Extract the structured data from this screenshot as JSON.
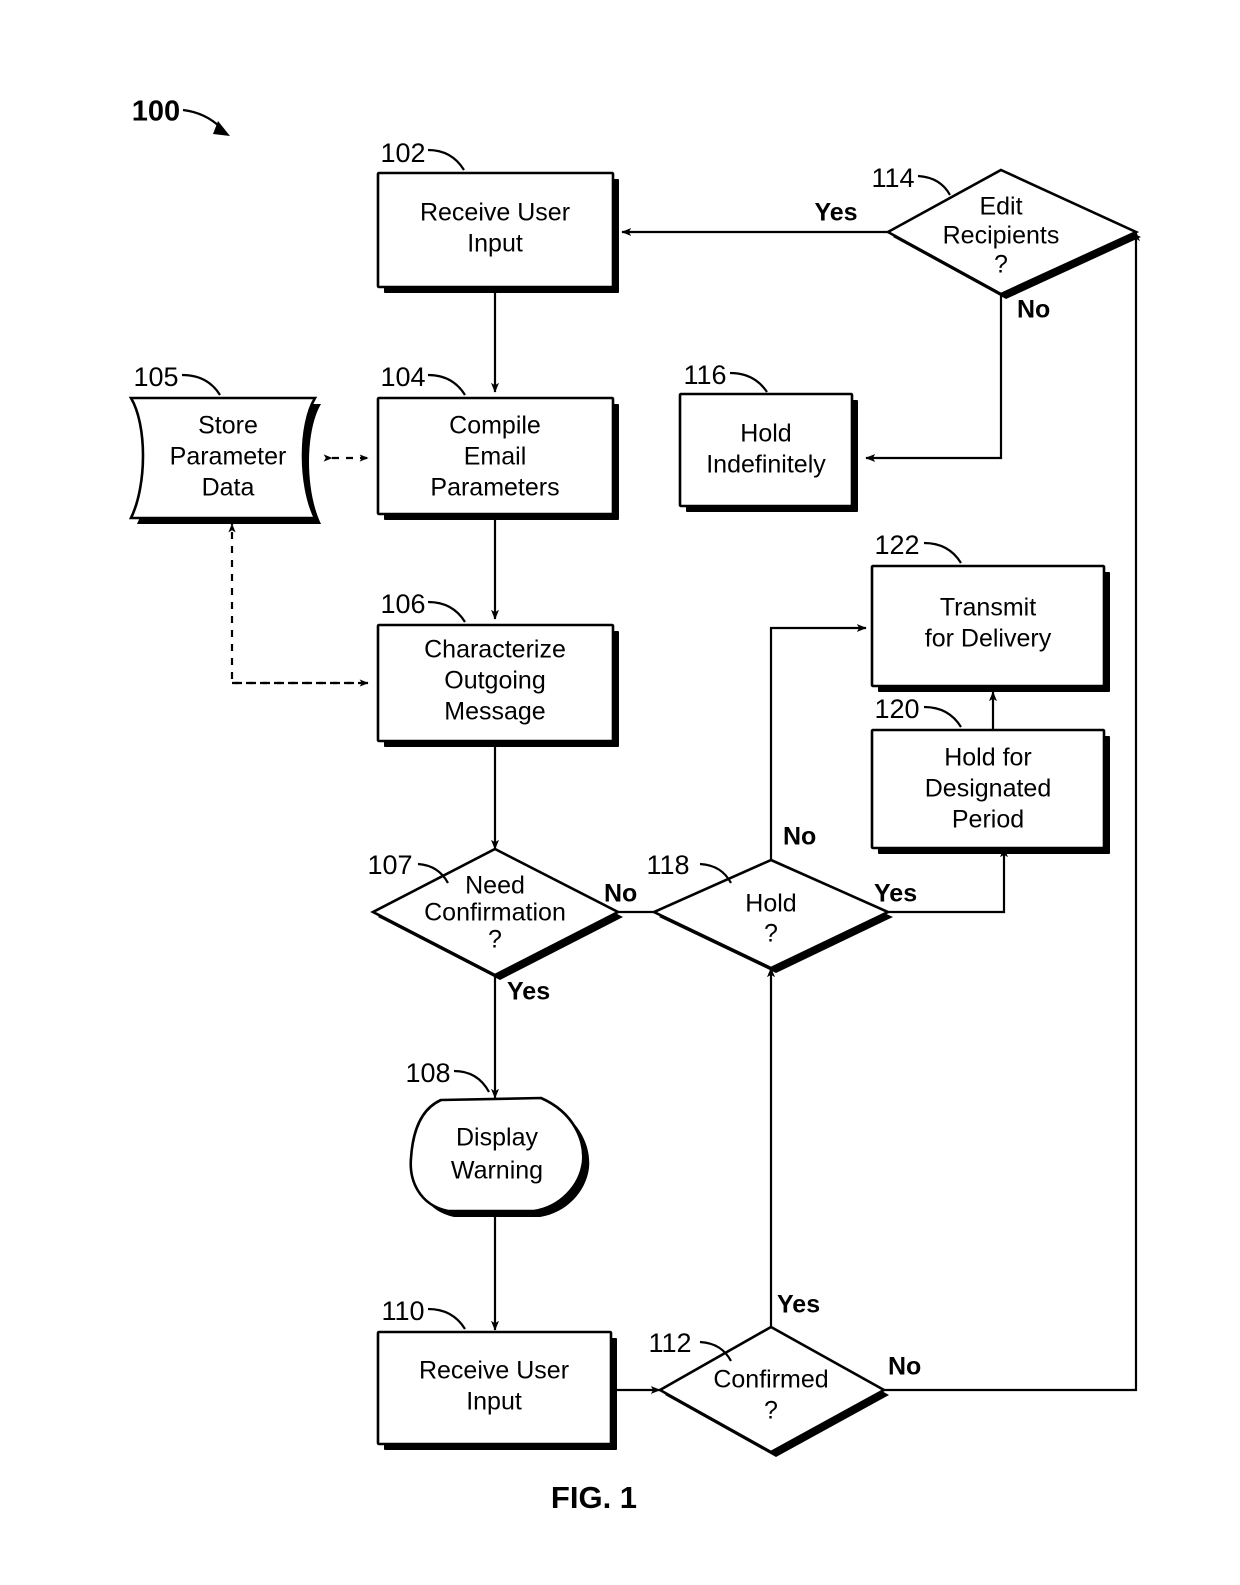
{
  "figure": {
    "caption": "FIG. 1",
    "diagram_ref": "100"
  },
  "nodes": {
    "n102": {
      "ref": "102",
      "label_line1": "Receive User",
      "label_line2": "Input",
      "shape": "process"
    },
    "n104": {
      "ref": "104",
      "label_line1": "Compile",
      "label_line2": "Email",
      "label_line3": "Parameters",
      "shape": "process"
    },
    "n105": {
      "ref": "105",
      "label_line1": "Store",
      "label_line2": "Parameter",
      "label_line3": "Data",
      "shape": "data-store"
    },
    "n106": {
      "ref": "106",
      "label_line1": "Characterize",
      "label_line2": "Outgoing",
      "label_line3": "Message",
      "shape": "process"
    },
    "n107": {
      "ref": "107",
      "label_line1": "Need",
      "label_line2": "Confirmation",
      "label_line3": "?",
      "shape": "decision"
    },
    "n108": {
      "ref": "108",
      "label_line1": "Display",
      "label_line2": "Warning",
      "shape": "display"
    },
    "n110": {
      "ref": "110",
      "label_line1": "Receive User",
      "label_line2": "Input",
      "shape": "process"
    },
    "n112": {
      "ref": "112",
      "label_line1": "Confirmed",
      "label_line2": "?",
      "shape": "decision"
    },
    "n114": {
      "ref": "114",
      "label_line1": "Edit",
      "label_line2": "Recipients",
      "label_line3": "?",
      "shape": "decision"
    },
    "n116": {
      "ref": "116",
      "label_line1": "Hold",
      "label_line2": "Indefinitely",
      "shape": "process"
    },
    "n118": {
      "ref": "118",
      "label_line1": "Hold",
      "label_line2": "?",
      "shape": "decision"
    },
    "n120": {
      "ref": "120",
      "label_line1": "Hold for",
      "label_line2": "Designated",
      "label_line3": "Period",
      "shape": "process"
    },
    "n122": {
      "ref": "122",
      "label_line1": "Transmit",
      "label_line2": "for Delivery",
      "shape": "process"
    }
  },
  "edge_labels": {
    "e114_yes": "Yes",
    "e114_no": "No",
    "e107_no": "No",
    "e107_yes": "Yes",
    "e118_no": "No",
    "e118_yes": "Yes",
    "e112_yes": "Yes",
    "e112_no": "No"
  },
  "colors": {
    "stroke": "#000000",
    "fill": "#ffffff",
    "background": "#ffffff"
  }
}
